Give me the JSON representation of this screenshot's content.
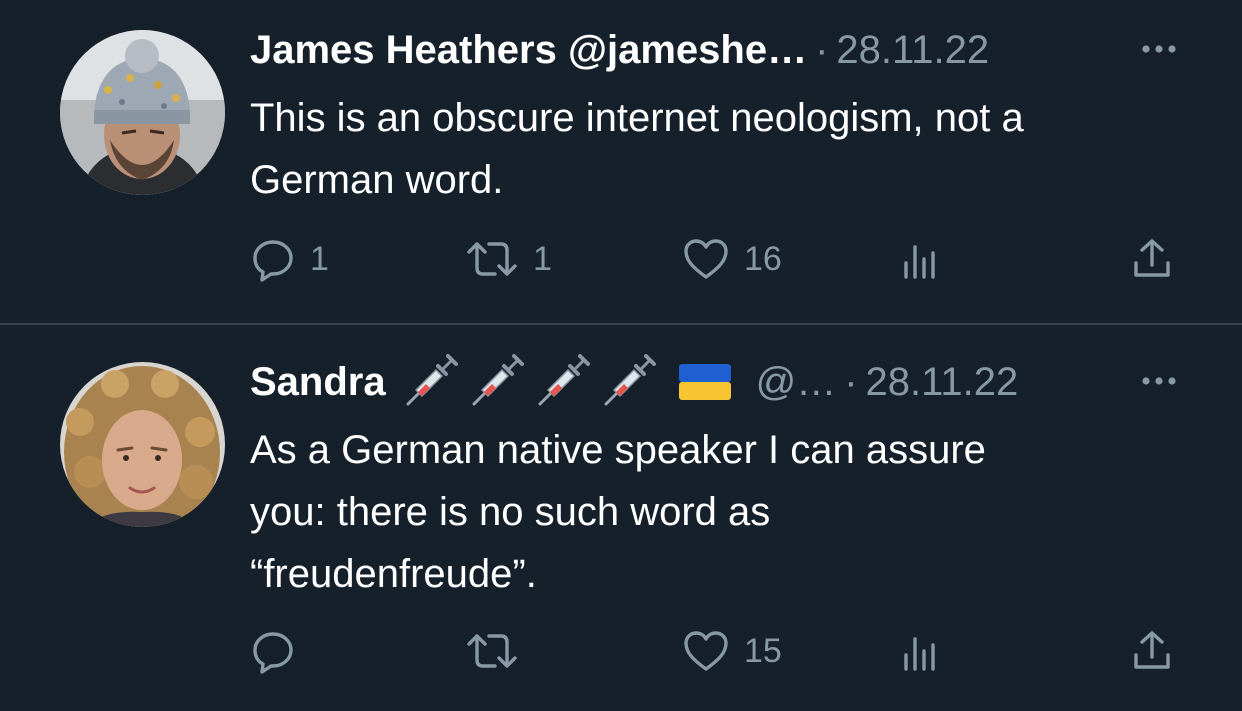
{
  "tweets": [
    {
      "author_name": "James Heathers @jameshe…",
      "handle": "",
      "separator": "·",
      "timestamp": "28.11.22",
      "text_lines": [
        "This is an obscure internet neologism, not a",
        "German word."
      ],
      "counts": {
        "replies": "1",
        "retweets": "1",
        "likes": "16"
      }
    },
    {
      "author_name": "Sandra",
      "emojis": [
        "syringe",
        "syringe",
        "syringe",
        "syringe",
        "ukraine-flag"
      ],
      "handle": "@…",
      "separator": "·",
      "timestamp": "28.11.22",
      "text_lines": [
        "As a German native speaker I can assure",
        "you: there is no such word as",
        "“freudenfreude”."
      ],
      "counts": {
        "replies": "",
        "retweets": "",
        "likes": "15"
      }
    }
  ],
  "icons": [
    "more-icon",
    "reply-icon",
    "retweet-icon",
    "like-icon",
    "views-icon",
    "share-icon"
  ],
  "colors": {
    "background": "#15202b",
    "secondary_text": "#8899a6",
    "divider": "#38444d",
    "primary_text": "#ffffff"
  }
}
